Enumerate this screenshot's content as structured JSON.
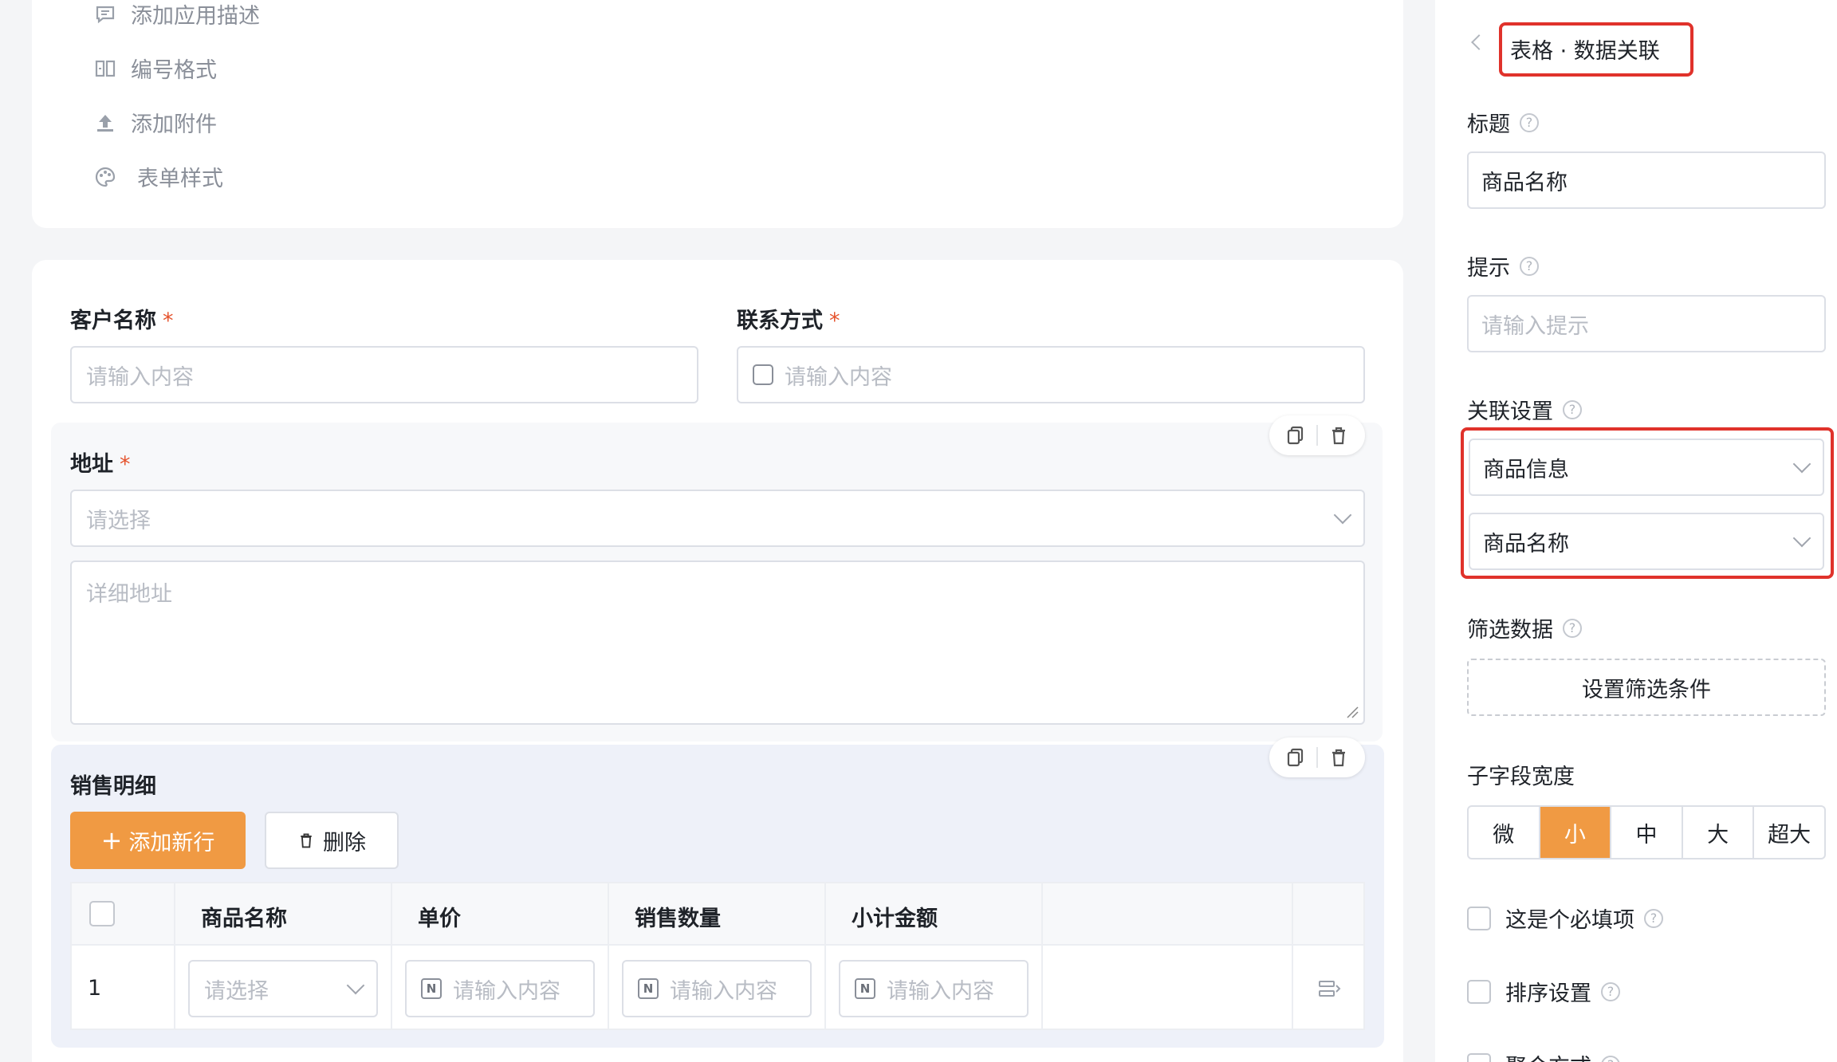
{
  "settings_menu": {
    "items": [
      {
        "label": "添加应用描述",
        "icon": "comment-icon"
      },
      {
        "label": "编号格式",
        "icon": "number-format-icon"
      },
      {
        "label": "添加附件",
        "icon": "upload-icon"
      },
      {
        "label": "表单样式",
        "icon": "palette-icon"
      }
    ]
  },
  "form": {
    "customer_name": {
      "label": "客户名称",
      "required_mark": "*",
      "placeholder": "请输入内容"
    },
    "contact": {
      "label": "联系方式",
      "required_mark": "*",
      "placeholder": "请输入内容"
    },
    "address": {
      "label": "地址",
      "required_mark": "*",
      "select_placeholder": "请选择",
      "detail_placeholder": "详细地址"
    },
    "sales_detail": {
      "label": "销售明细",
      "add_row_label": "添加新行",
      "delete_label": "删除",
      "columns": [
        "商品名称",
        "单价",
        "销售数量",
        "小计金额"
      ],
      "rows": [
        {
          "index": "1",
          "product_placeholder": "请选择",
          "price_placeholder": "请输入内容",
          "qty_placeholder": "请输入内容",
          "subtotal_placeholder": "请输入内容"
        }
      ]
    }
  },
  "panel": {
    "title": "表格 · 数据关联",
    "title_field": {
      "label": "标题",
      "value": "商品名称"
    },
    "hint_field": {
      "label": "提示",
      "placeholder": "请输入提示"
    },
    "link_settings": {
      "label": "关联设置",
      "source": "商品信息",
      "field": "商品名称"
    },
    "filter": {
      "label": "筛选数据",
      "button": "设置筛选条件"
    },
    "width": {
      "label": "子字段宽度",
      "options": [
        "微",
        "小",
        "中",
        "大",
        "超大"
      ],
      "selected": "小"
    },
    "required": {
      "label": "这是个必填项"
    },
    "sort": {
      "label": "排序设置"
    },
    "aggregate": {
      "label": "聚合方式"
    }
  },
  "colors": {
    "accent": "#f09a43",
    "highlight": "#e0322b",
    "required": "#e5532d"
  }
}
